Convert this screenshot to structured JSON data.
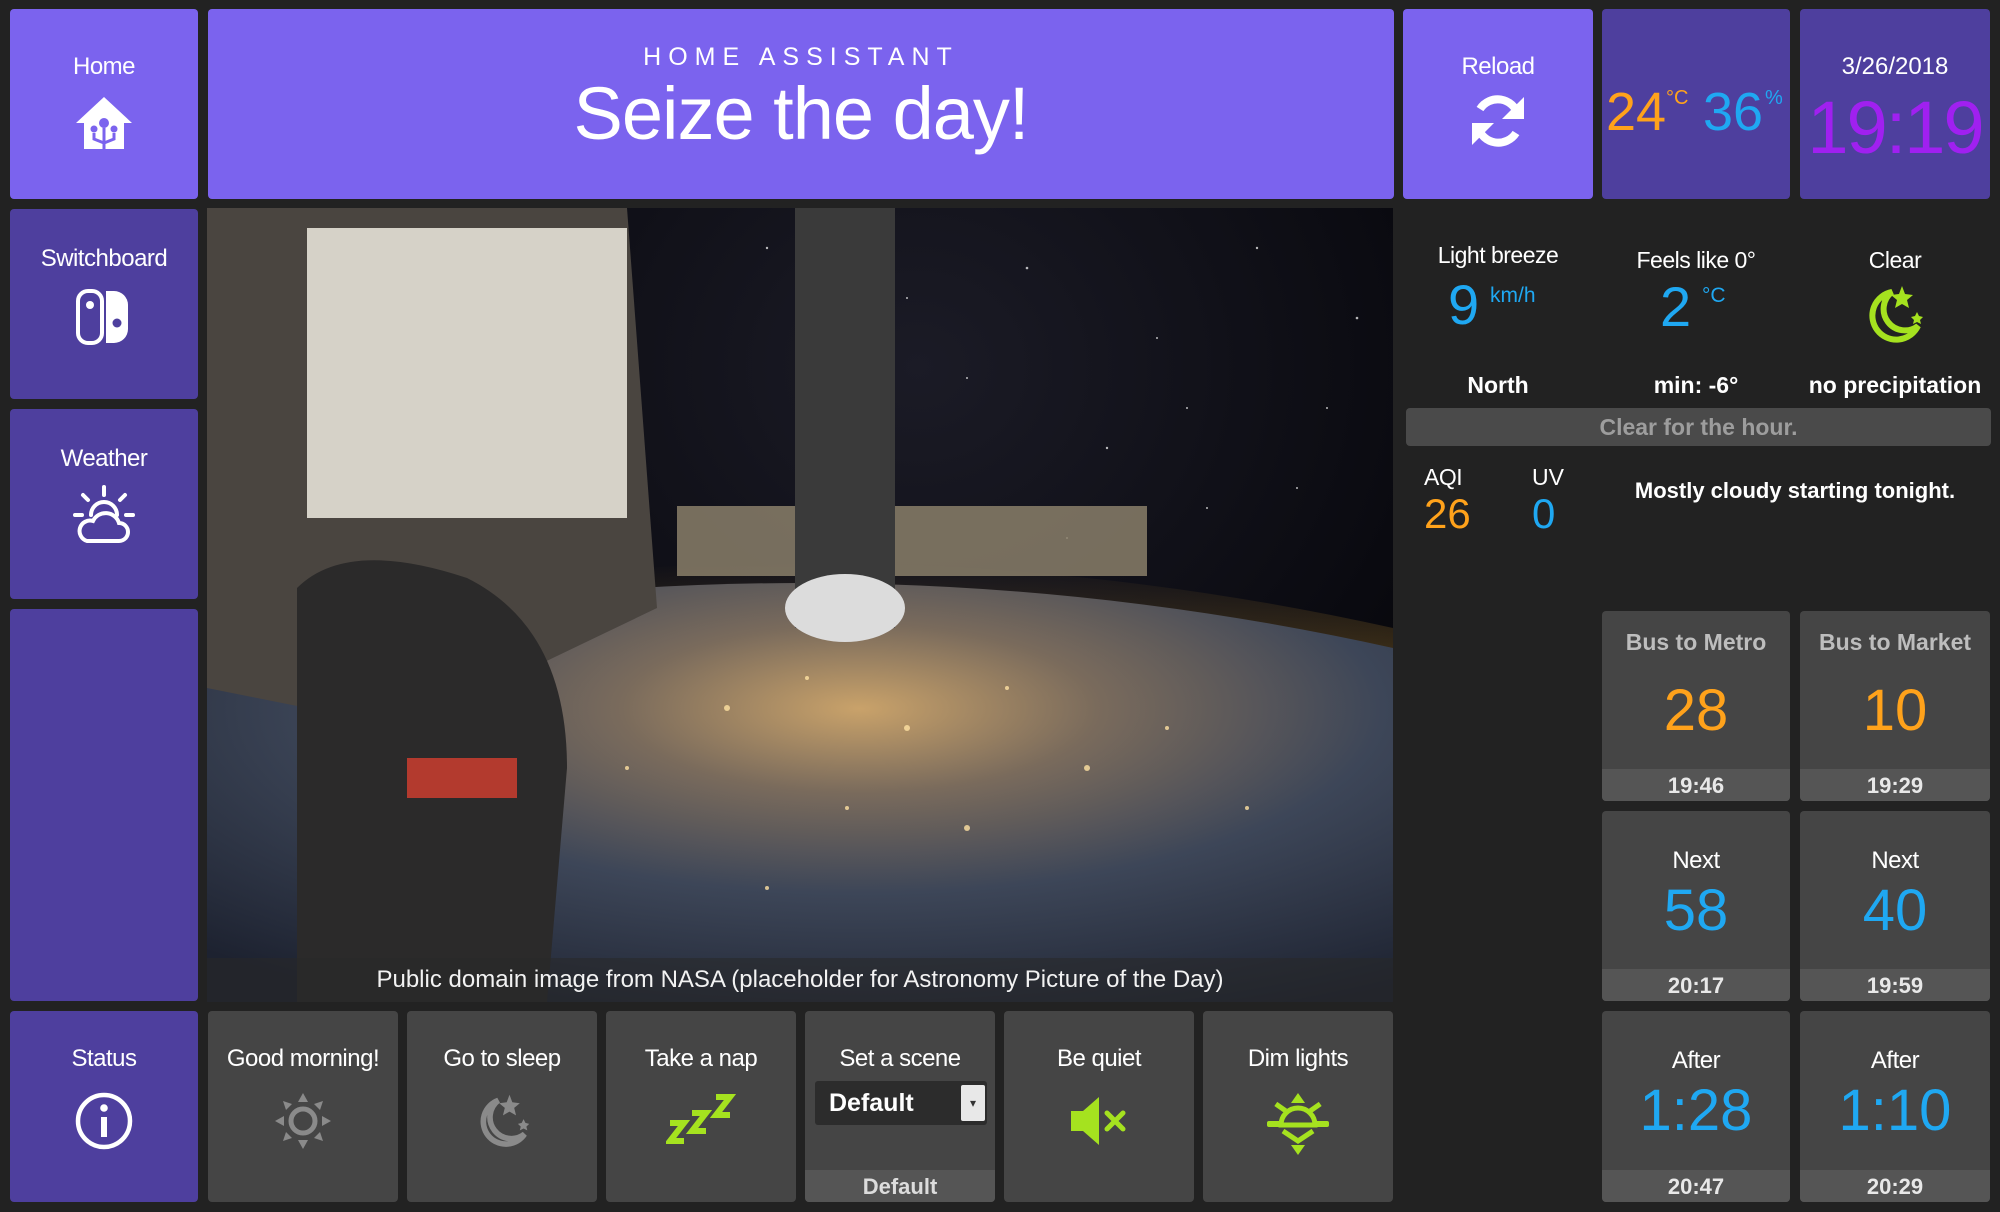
{
  "colors": {
    "accent": "#7b63ee",
    "tile_dark_violet": "#4e3f9e",
    "tile_grey": "#454545",
    "value_blue": "#1fa8f2",
    "value_orange": "#ffa21b",
    "clock_purple": "#a020f0",
    "icon_green": "#a5e21f"
  },
  "nav": {
    "home": {
      "label": "Home",
      "icon": "home-assistant-icon"
    },
    "switchboard": {
      "label": "Switchboard",
      "icon": "switch-controller-icon"
    },
    "weather": {
      "label": "Weather",
      "icon": "partly-cloudy-icon"
    },
    "status": {
      "label": "Status",
      "icon": "info-icon"
    }
  },
  "header": {
    "app_name": "HOME ASSISTANT",
    "headline": "Seize the day!"
  },
  "reload": {
    "label": "Reload",
    "icon": "reload-icon"
  },
  "climate": {
    "temp": "24",
    "temp_unit": "°C",
    "humidity": "36",
    "humidity_unit": "%"
  },
  "clock": {
    "date": "3/26/2018",
    "time": "19:19"
  },
  "weather": {
    "wind": {
      "label": "Light breeze",
      "value": "9",
      "unit": "km/h",
      "direction": "North"
    },
    "feels": {
      "label": "Feels like 0°",
      "value": "2",
      "unit": "°C",
      "min": "min: -6°"
    },
    "condition": {
      "label": "Clear",
      "icon": "moon-stars-icon",
      "precip": "no precipitation"
    },
    "hour_summary": "Clear for the hour.",
    "aqi": {
      "label": "AQI",
      "value": "26"
    },
    "uv": {
      "label": "UV",
      "value": "0"
    },
    "forecast": "Mostly cloudy starting tonight."
  },
  "buses": [
    {
      "title": "Bus to Metro",
      "minutes": "28",
      "time": "19:46"
    },
    {
      "title": "Bus to Market",
      "minutes": "10",
      "time": "19:29"
    },
    {
      "title": "Next",
      "minutes": "58",
      "time": "20:17"
    },
    {
      "title": "Next",
      "minutes": "40",
      "time": "19:59"
    },
    {
      "title": "After",
      "minutes": "1:28",
      "time": "20:47"
    },
    {
      "title": "After",
      "minutes": "1:10",
      "time": "20:29"
    }
  ],
  "photo": {
    "caption": "Public domain image from NASA (placeholder for Astronomy Picture of the Day)"
  },
  "actions": [
    {
      "label": "Good morning!",
      "icon": "sun-icon"
    },
    {
      "label": "Go to sleep",
      "icon": "moon-icon"
    },
    {
      "label": "Take a nap",
      "icon": "zzz-icon"
    },
    {
      "label": "Set a scene",
      "select_value": "Default",
      "footer": "Default"
    },
    {
      "label": "Be quiet",
      "icon": "mute-icon"
    },
    {
      "label": "Dim lights",
      "icon": "dim-lights-icon"
    }
  ]
}
